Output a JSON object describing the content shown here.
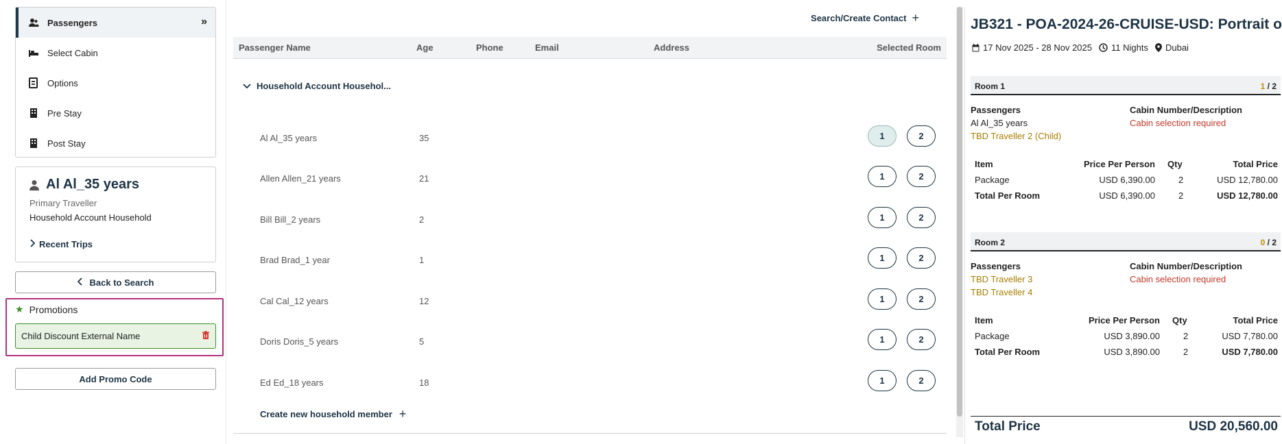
{
  "steps": [
    {
      "label": "Passengers",
      "icon": "user-group-icon"
    },
    {
      "label": "Select Cabin",
      "icon": "bed-icon"
    },
    {
      "label": "Options",
      "icon": "options-icon"
    },
    {
      "label": "Pre Stay",
      "icon": "building-icon"
    },
    {
      "label": "Post Stay",
      "icon": "building-icon"
    }
  ],
  "traveler": {
    "name": "Al Al_35 years",
    "role": "Primary Traveller",
    "household": "Household Account Household",
    "recent_trips": "Recent Trips"
  },
  "back_to_search": "Back to Search",
  "promotions": {
    "title": "Promotions",
    "item": "Child Discount External Name",
    "add_promo": "Add Promo Code"
  },
  "center": {
    "search_contact": "Search/Create Contact",
    "columns": {
      "name": "Passenger Name",
      "age": "Age",
      "phone": "Phone",
      "email": "Email",
      "address": "Address",
      "room": "Selected Room"
    },
    "group_label": "Household Account Househol...",
    "passengers": [
      {
        "name": "Al Al_35 years",
        "age": "35",
        "b1": "1",
        "b2": "2"
      },
      {
        "name": "Allen Allen_21 years",
        "age": "21",
        "b1": "1",
        "b2": "2"
      },
      {
        "name": "Bill Bill_2 years",
        "age": "2",
        "b1": "1",
        "b2": "2"
      },
      {
        "name": "Brad Brad_1 year",
        "age": "1",
        "b1": "1",
        "b2": "2"
      },
      {
        "name": "Cal Cal_12 years",
        "age": "12",
        "b1": "1",
        "b2": "2"
      },
      {
        "name": "Doris Doris_5 years",
        "age": "5",
        "b1": "1",
        "b2": "2"
      },
      {
        "name": "Ed Ed_18 years",
        "age": "18",
        "b1": "1",
        "b2": "2"
      }
    ],
    "create_member": "Create new household member"
  },
  "summary": {
    "title": "JB321 - POA-2024-26-CRUISE-USD: Portrait o...",
    "dates": "17 Nov 2025 - 28 Nov 2025",
    "nights": "11 Nights",
    "location": "Dubai",
    "rooms": [
      {
        "label": "Room 1",
        "filled": "1",
        "cap": "/ 2",
        "passengers_header": "Passengers",
        "cabin_header": "Cabin Number/Description",
        "cabin_status": "Cabin selection required",
        "pax": [
          "Al Al_35 years",
          "TBD Traveller 2 (Child)"
        ],
        "items_header": {
          "item": "Item",
          "ppp": "Price Per Person",
          "qty": "Qty",
          "total": "Total Price"
        },
        "package": {
          "label": "Package",
          "ppp": "USD 6,390.00",
          "qty": "2",
          "total": "USD 12,780.00"
        },
        "per_room": {
          "label": "Total Per Room",
          "ppp": "USD 6,390.00",
          "qty": "2",
          "total": "USD 12,780.00"
        }
      },
      {
        "label": "Room 2",
        "filled": "0",
        "cap": "/ 2",
        "passengers_header": "Passengers",
        "cabin_header": "Cabin Number/Description",
        "cabin_status": "Cabin selection required",
        "pax": [
          "TBD Traveller 3",
          "TBD Traveller 4"
        ],
        "items_header": {
          "item": "Item",
          "ppp": "Price Per Person",
          "qty": "Qty",
          "total": "Total Price"
        },
        "package": {
          "label": "Package",
          "ppp": "USD 3,890.00",
          "qty": "2",
          "total": "USD 7,780.00"
        },
        "per_room": {
          "label": "Total Per Room",
          "ppp": "USD 3,890.00",
          "qty": "2",
          "total": "USD 7,780.00"
        }
      }
    ],
    "total_label": "Total Price",
    "total_value": "USD 20,560.00"
  }
}
